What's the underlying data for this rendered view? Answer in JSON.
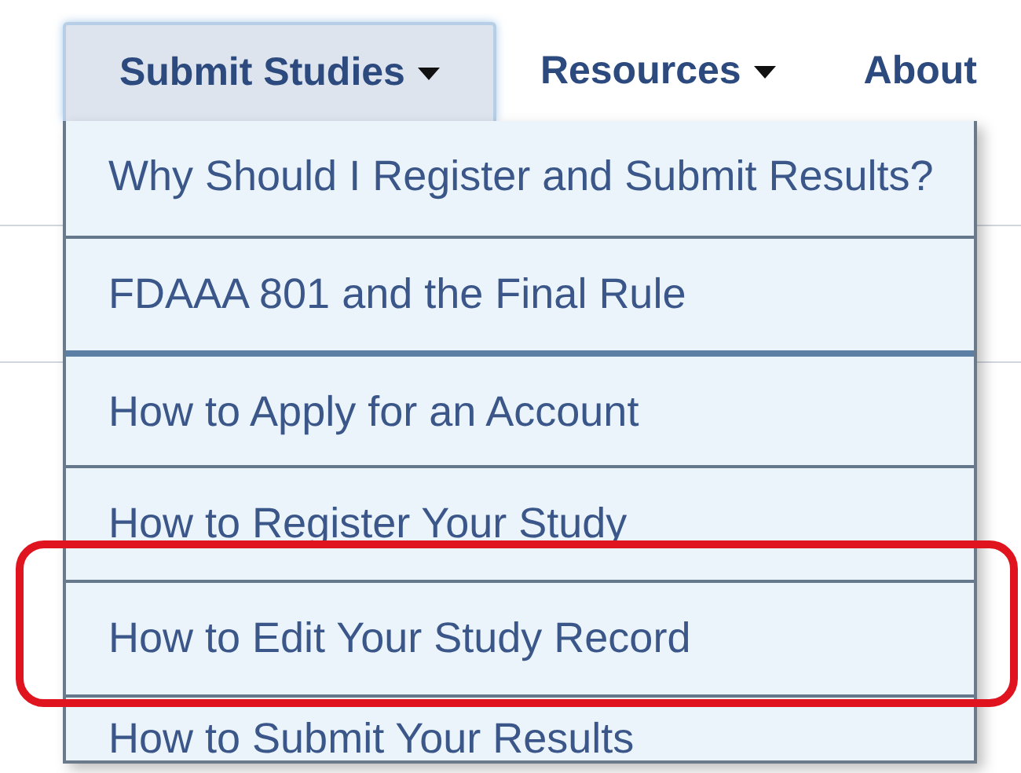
{
  "nav": [
    {
      "label": "Submit Studies",
      "dropdown": true,
      "selected": true
    },
    {
      "label": "Resources",
      "dropdown": true,
      "selected": false
    },
    {
      "label": "About",
      "dropdown": false,
      "selected": false
    }
  ],
  "menu": [
    {
      "label": "Why Should I Register and Submit Results?",
      "highlighted": false
    },
    {
      "label": "FDAAA 801 and the Final Rule",
      "highlighted": false
    },
    {
      "label": "How to Apply for an Account",
      "highlighted": false
    },
    {
      "label": "How to Register Your Study",
      "highlighted": false
    },
    {
      "label": "How to Edit Your Study Record",
      "highlighted": true
    },
    {
      "label": "How to Submit Your Results",
      "highlighted": false
    }
  ]
}
